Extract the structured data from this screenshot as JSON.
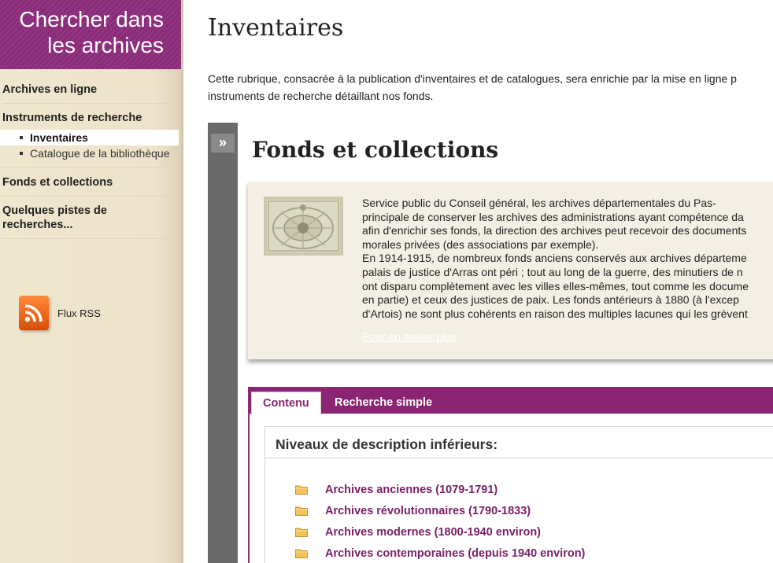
{
  "sidebar": {
    "header": "Chercher dans les archives",
    "header_line1": "Chercher dans",
    "header_line2": "les archives",
    "nav": [
      {
        "label": "Archives en ligne"
      },
      {
        "label": "Instruments de recherche",
        "children": [
          {
            "label": "Inventaires",
            "active": true
          },
          {
            "label": "Catalogue de la bibliothèque",
            "active": false
          }
        ]
      },
      {
        "label": "Fonds et collections"
      },
      {
        "label": "Quelques pistes de recherches..."
      }
    ],
    "rss_label": "Flux RSS"
  },
  "main": {
    "title": "Inventaires",
    "intro_line1": "Cette rubrique, consacrée à la publication d'inventaires et de catalogues, sera enrichie par la mise en ligne p",
    "intro_line2": "instruments de recherche détaillant nos fonds."
  },
  "panel": {
    "expand_glyph": "»",
    "title": "Fonds et collections",
    "info_text": "Service public du Conseil général, les archives départementales du Pas-\nprincipale de conserver les archives des administrations ayant compétence da\nafin d'enrichir ses fonds, la direction des archives peut recevoir des documents\nmorales privées (des associations par exemple).\nEn 1914-1915, de nombreux fonds anciens conservés aux archives départeme\npalais de justice d'Arras ont péri ; tout au long de la guerre, des minutiers de n\nont disparu complètement avec les villes elles-mêmes, tout comme les docume\nen partie) et ceux des justices de paix. Les fonds antérieurs à 1880 (à l'excep\nd'Artois) ne sont plus cohérents en raison des multiples lacunes qui les grèvent",
    "more_link": "Pour en savoir plus",
    "tabs": [
      {
        "label": "Contenu",
        "active": true
      },
      {
        "label": "Recherche simple",
        "active": false
      }
    ],
    "levels_title": "Niveaux de description inférieurs:",
    "levels": [
      {
        "label": "Archives anciennes (1079-1791)"
      },
      {
        "label": "Archives révolutionnaires (1790-1833)"
      },
      {
        "label": "Archives modernes (1800-1940 environ)"
      },
      {
        "label": "Archives contemporaines (depuis 1940 environ)"
      }
    ]
  },
  "colors": {
    "brand": "#8b2c7a",
    "sidebar_bg": "#efe6cf",
    "link": "#7a1f66",
    "info_bg": "#f4efe4"
  }
}
